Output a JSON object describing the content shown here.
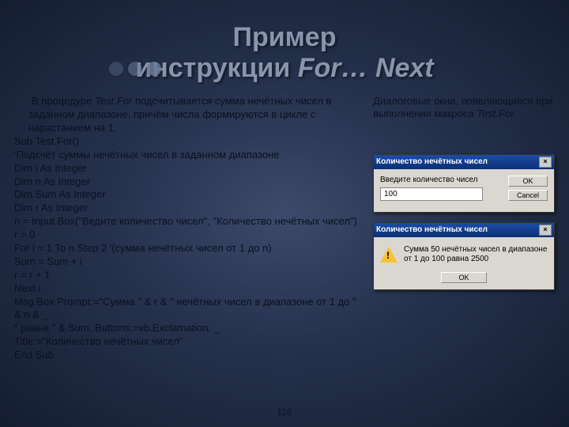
{
  "title_line1": "Пример",
  "title_line2_a": "инструкции",
  "title_line2_b": "For… Next",
  "intro_a": "В процедуре ",
  "intro_it": "Test.For",
  "intro_b": " подсчитывается сумма нечётных чисел в заданном диапазоне, причём числа формируются в цикле с нарастанием на 1.",
  "code": {
    "l1": "Sub Test.For()",
    "l2": "'Подсчёт суммы нечётных чисел в заданном диапазоне",
    "l3": "Dim i As Integer",
    "l4": "Dim n As Integer",
    "l5": "Dim Sum As Integer",
    "l6": "Dim r As Integer",
    "l7": "n = Input.Box(\"Ведите количество чисел\", \"Количество нечётных чисел\")",
    "l8": " r = 0",
    "l9": "For i = 1 To n Step 2 '(сумма нечётных чисел от 1 до n)",
    "l10": "Sum = Sum + i",
    "l11": "r = r + 1",
    "l12": "Next i",
    "l13": "Msg.Box Prompt:=\"Сумма \" & r & \" нечётных чисел в диапазоне от 1 до \" & n & _",
    "l14": "\" равна \" & Sum, Buttons:=vb.Exclamation, _",
    "l15": "Title:=\"Количество нечётных чисел\"",
    "l16": "End Sub"
  },
  "note_a": "Диалоговые окна, появляющиеся при выполнении макроса ",
  "note_it": "Test.For.",
  "win1": {
    "title": "Количество нечётных чисел",
    "prompt": "Введите количество чисел",
    "value": "100",
    "ok": "OK",
    "cancel": "Cancel"
  },
  "win2": {
    "title": "Количество нечётных чисел",
    "msg": "Сумма 50 нечётных чисел в диапазоне от 1 до 100 равна 2500",
    "ok": "OK"
  },
  "page": "116"
}
